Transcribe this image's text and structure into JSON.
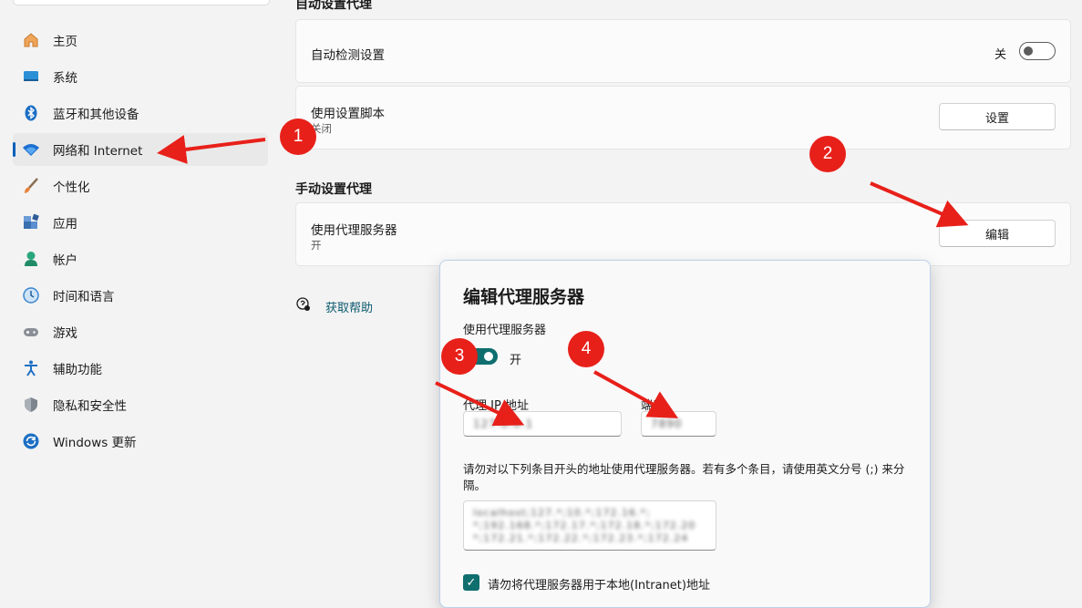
{
  "sidebar": {
    "items": [
      {
        "label": "主页",
        "icon": "home-icon"
      },
      {
        "label": "系统",
        "icon": "system-icon"
      },
      {
        "label": "蓝牙和其他设备",
        "icon": "bluetooth-icon"
      },
      {
        "label": "网络和 Internet",
        "icon": "wifi-icon"
      },
      {
        "label": "个性化",
        "icon": "brush-icon"
      },
      {
        "label": "应用",
        "icon": "apps-icon"
      },
      {
        "label": "帐户",
        "icon": "account-icon"
      },
      {
        "label": "时间和语言",
        "icon": "clock-globe-icon"
      },
      {
        "label": "游戏",
        "icon": "gamepad-icon"
      },
      {
        "label": "辅助功能",
        "icon": "accessibility-icon"
      },
      {
        "label": "隐私和安全性",
        "icon": "shield-icon"
      },
      {
        "label": "Windows 更新",
        "icon": "update-icon"
      }
    ]
  },
  "main": {
    "auto_section_title": "自动设置代理",
    "auto_detect": {
      "title": "自动检测设置",
      "state_label": "关"
    },
    "setup_script": {
      "title": "使用设置脚本",
      "subtitle": "关闭",
      "button": "设置"
    },
    "manual_section_title": "手动设置代理",
    "proxy_server": {
      "title": "使用代理服务器",
      "subtitle": "开",
      "button": "编辑"
    },
    "help_link": "获取帮助"
  },
  "dialog": {
    "title": "编辑代理服务器",
    "use_proxy_label": "使用代理服务器",
    "toggle_state": "开",
    "ip_label": "代理 IP 地址",
    "ip_value": "127.0.0.1",
    "port_label": "端口",
    "port_value": "7890",
    "exceptions_desc": "请勿对以下列条目开头的地址使用代理服务器。若有多个条目，请使用英文分号 (;) 来分隔。",
    "exceptions_lines": [
      "localhost;127.*;10.*;172.16.*;",
      "*;192.168.*;172.17.*;172.18.*;172.20",
      "*;172.21.*;172.22.*;172.23.*;172.24"
    ],
    "local_checkbox_label": "请勿将代理服务器用于本地(Intranet)地址"
  },
  "annotations": {
    "badges": [
      "1",
      "2",
      "3",
      "4"
    ]
  },
  "colors": {
    "accent": "#005fb8",
    "toggle_on": "#0f6e6e",
    "badge": "#e8201a"
  }
}
